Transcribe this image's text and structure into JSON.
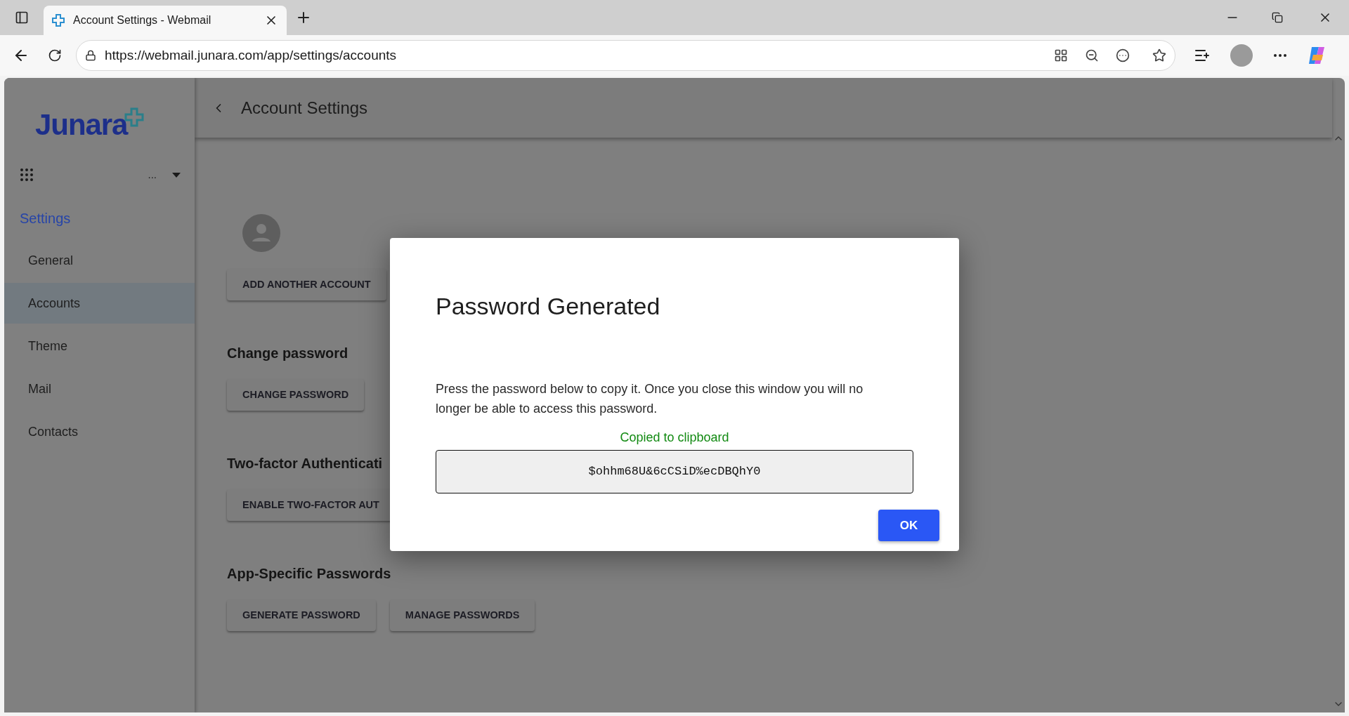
{
  "browser": {
    "tab_title": "Account Settings - Webmail",
    "url": "https://webmail.junara.com/app/settings/accounts"
  },
  "app": {
    "logo": "Junara",
    "account_menu": "...",
    "sidebar": {
      "heading": "Settings",
      "items": [
        {
          "label": "General",
          "selected": false
        },
        {
          "label": "Accounts",
          "selected": true
        },
        {
          "label": "Theme",
          "selected": false
        },
        {
          "label": "Mail",
          "selected": false
        },
        {
          "label": "Contacts",
          "selected": false
        }
      ]
    },
    "header": {
      "title": "Account Settings"
    },
    "sections": [
      {
        "kind": "account",
        "buttons": [
          "ADD ANOTHER ACCOUNT"
        ]
      },
      {
        "kind": "group",
        "heading": "Change password",
        "buttons": [
          "CHANGE PASSWORD"
        ]
      },
      {
        "kind": "group",
        "heading": "Two-factor Authenticati",
        "buttons": [
          "ENABLE TWO-FACTOR AUT"
        ]
      },
      {
        "kind": "group",
        "heading": "App-Specific Passwords",
        "buttons": [
          "GENERATE PASSWORD",
          "MANAGE PASSWORDS"
        ]
      }
    ]
  },
  "dialog": {
    "title": "Password Generated",
    "message": "Press the password below to copy it. Once you close this window you will no longer be able to access this password.",
    "status": "Copied to clipboard",
    "password": "$ohhm68U&6cCSiD%ecDBQhY0",
    "button": "OK"
  }
}
